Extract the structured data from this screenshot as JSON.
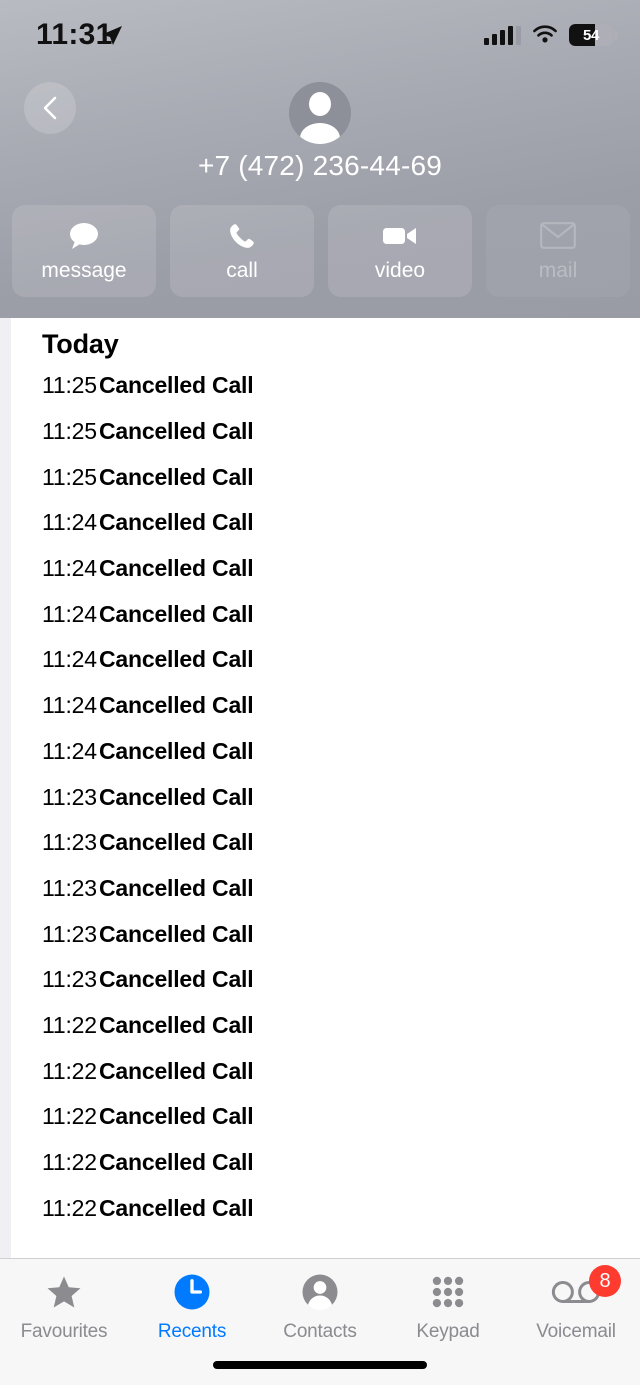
{
  "status_bar": {
    "time": "11:31",
    "location_icon": "location-arrow-icon",
    "signal_icon": "cellular-signal-icon",
    "wifi_icon": "wifi-icon",
    "battery_percent": "54",
    "battery_icon": "battery-icon"
  },
  "header": {
    "back_icon": "chevron-left-icon",
    "avatar_icon": "person-avatar-icon",
    "phone_number": "+7 (472) 236-44-69",
    "accent_color": "#007aff",
    "background_color": "#9b9da7"
  },
  "actions": [
    {
      "label": "message",
      "icon": "message-bubble-icon",
      "disabled": false
    },
    {
      "label": "call",
      "icon": "phone-handset-icon",
      "disabled": false
    },
    {
      "label": "video",
      "icon": "video-camera-icon",
      "disabled": false
    },
    {
      "label": "mail",
      "icon": "envelope-icon",
      "disabled": true
    }
  ],
  "call_list": {
    "section_title": "Today",
    "rows": [
      {
        "time": "11:25",
        "status": "Cancelled Call"
      },
      {
        "time": "11:25",
        "status": "Cancelled Call"
      },
      {
        "time": "11:25",
        "status": "Cancelled Call"
      },
      {
        "time": "11:24",
        "status": "Cancelled Call"
      },
      {
        "time": "11:24",
        "status": "Cancelled Call"
      },
      {
        "time": "11:24",
        "status": "Cancelled Call"
      },
      {
        "time": "11:24",
        "status": "Cancelled Call"
      },
      {
        "time": "11:24",
        "status": "Cancelled Call"
      },
      {
        "time": "11:24",
        "status": "Cancelled Call"
      },
      {
        "time": "11:23",
        "status": "Cancelled Call"
      },
      {
        "time": "11:23",
        "status": "Cancelled Call"
      },
      {
        "time": "11:23",
        "status": "Cancelled Call"
      },
      {
        "time": "11:23",
        "status": "Cancelled Call"
      },
      {
        "time": "11:23",
        "status": "Cancelled Call"
      },
      {
        "time": "11:22",
        "status": "Cancelled Call"
      },
      {
        "time": "11:22",
        "status": "Cancelled Call"
      },
      {
        "time": "11:22",
        "status": "Cancelled Call"
      },
      {
        "time": "11:22",
        "status": "Cancelled Call"
      },
      {
        "time": "11:22",
        "status": "Cancelled Call"
      }
    ]
  },
  "tab_bar": {
    "active_color": "#007aff",
    "inactive_color": "#8b8b90",
    "badge_color": "#ff3b30",
    "tabs": [
      {
        "label": "Favourites",
        "icon": "star-icon",
        "active": false,
        "badge": ""
      },
      {
        "label": "Recents",
        "icon": "clock-icon",
        "active": true,
        "badge": ""
      },
      {
        "label": "Contacts",
        "icon": "person-icon",
        "active": false,
        "badge": ""
      },
      {
        "label": "Keypad",
        "icon": "keypad-icon",
        "active": false,
        "badge": ""
      },
      {
        "label": "Voicemail",
        "icon": "voicemail-icon",
        "active": false,
        "badge": "8"
      }
    ]
  }
}
